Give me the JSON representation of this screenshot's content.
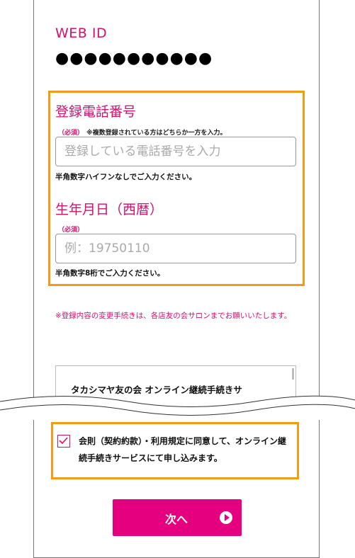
{
  "webid": {
    "label": "WEB ID",
    "value": "●●●●●●●●●●●"
  },
  "tel": {
    "title": "登録電話番号",
    "required": "（必須）",
    "note": "※複数登録されている方はどちらか一方を入力。",
    "placeholder": "登録している電話番号を入力",
    "hint": "半角数字ハイフンなしでご入力ください。"
  },
  "dob": {
    "title": "生年月日（西暦）",
    "required": "（必須）",
    "placeholder": "例：19750110",
    "hint": "半角数字8桁でご入力ください。"
  },
  "notice": "※登録内容の変更手続きは、各店友の会サロンまでお願いいたします。",
  "terms": {
    "title": "タカシマヤ友の会 オンライン継続手続きサ"
  },
  "agree": {
    "checked": true,
    "text": "会則（契約約款）・利用規定に同意して、オンライン継続手続きサービスにて申し込みます。"
  },
  "next_button": {
    "label": "次へ"
  },
  "colors": {
    "brand": "#e4007f",
    "accent_text": "#d1106f",
    "highlight": "#f29a1c"
  },
  "icons": {
    "checkbox": "check-icon",
    "next": "arrow-right-circle-icon"
  }
}
